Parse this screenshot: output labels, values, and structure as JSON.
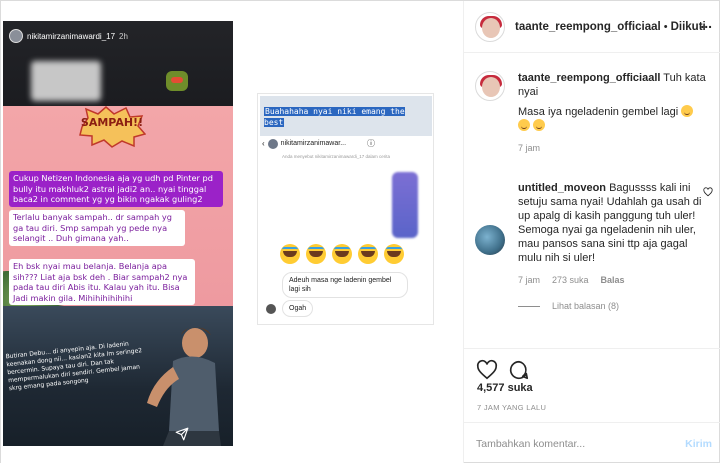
{
  "post": {
    "author": "taante_reempong_officiaal",
    "follow_label": "Diikuti",
    "dot": "•",
    "more": "...",
    "likes": "4,577 suka",
    "time_ago": "7 JAM YANG LALU",
    "comment_placeholder": "Tambahkan komentar...",
    "send_label": "Kirim"
  },
  "caption": {
    "user": "taante_reempong_officiaall",
    "text_1": "Tuh kata nyai",
    "text_2": "Masa iya ngeladenin gembel lagi",
    "meta_time": "7 jam"
  },
  "comment": {
    "user": "untitled_moveon",
    "text": "Bagussss kali ini setuju sama nyai! Udahlah ga usah di up apalg di kasih panggung tuh uler! Semoga nyai ga ngeladenin nih uler, mau pansos sana sini ttp aja gagal mulu nih si uler!",
    "meta_time": "7 jam",
    "meta_likes": "273 suka",
    "reply_label": "Balas",
    "view_replies": "Lihat balasan (8)"
  },
  "story": {
    "username": "nikitamirzanimawardi_17",
    "time": "2h",
    "sampah": "SAMPAH!!",
    "caption_purple": "Cukup Netizen Indonesia aja yg udh pd Pinter pd bully itu makhluk2 astral jadi2 an.. nyai tinggal baca2 in comment yg yg bikin ngakak guling2",
    "caption_white_1": "Terlalu banyak sampah.. dr sampah yg ga tau diri. Smp sampah yg pede nya selangit .. Duh gimana yah..",
    "caption_white_2": "Eh bsk nyai mau belanja. Belanja apa sih??? Liat aja bsk deh . Biar sampah2 nya pada tau diri Abis itu. Kalau yah itu. Bisa Jadi makin gila. Mihihihihihihi",
    "small_text": "Butiran Debu... di anyepin aja. Di ladenin keenakan dong nii... kasian2 kita lm seringe2 bercermin. Supaya tau diri. Dan tak mempermalukan diri sendiri. Gembel jaman skrg emang pada songong"
  },
  "inset": {
    "banner": "Buahahaha nyai niki emang the best",
    "username": "nikitamirzanimawar...",
    "subtitle": "Anda menyebut nikitamirzanimawardi_17 dalam cerita",
    "bubble_1": "Adeuh masa nge ladenin gembel lagi sih",
    "bubble_2": "Ogah"
  }
}
